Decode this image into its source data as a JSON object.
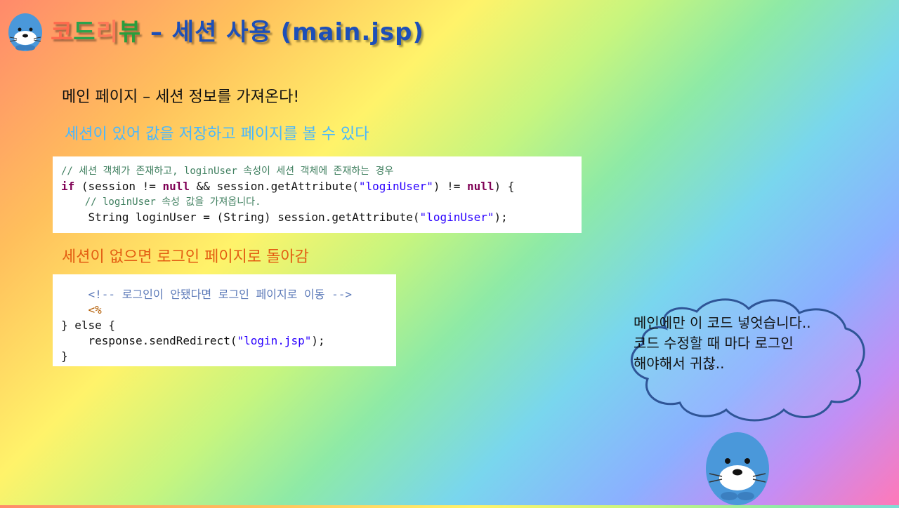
{
  "title": {
    "c1": "코",
    "c2": "드",
    "c3": "리",
    "c4": "뷰",
    "rest": " – 세션 사용 (main.jsp)"
  },
  "intro": "메인 페이지 – 세션 정보를 가져온다!",
  "has_session_label": "세션이 있어 값을 저장하고 페이지를 볼 수 있다",
  "code_block_1": [
    "// 세션 객체가 존재하고, loginUser 속성이 세션 객체에 존재하는 경우",
    "if (session != null && session.getAttribute(\"loginUser\") != null) {",
    "    // loginUser 속성 값을 가져옵니다.",
    "    String loginUser = (String) session.getAttribute(\"loginUser\");"
  ],
  "no_session_label": "세션이 없으면 로그인 페이지로 돌아감",
  "code_block_2": [
    "    <!-- 로그인이 안됐다면 로그인 페이지로 이동 -->",
    "    <%",
    "} else {",
    "    response.sendRedirect(\"login.jsp\");",
    "}"
  ],
  "speech_bubble": {
    "line1": "메인에만 이 코드 넣엇습니다..",
    "line2": "코드 수정할 때 마다 로그인 해야해서 귀찮.."
  },
  "colors": {
    "title_blue": "#1d4fb8",
    "label_blue": "#47b7ff",
    "label_orange": "#e35d12",
    "cloud_outline": "#2f5597"
  },
  "icons": {
    "top_mascot": "seal-mascot-icon",
    "bottom_mascot": "seal-mascot-icon"
  }
}
